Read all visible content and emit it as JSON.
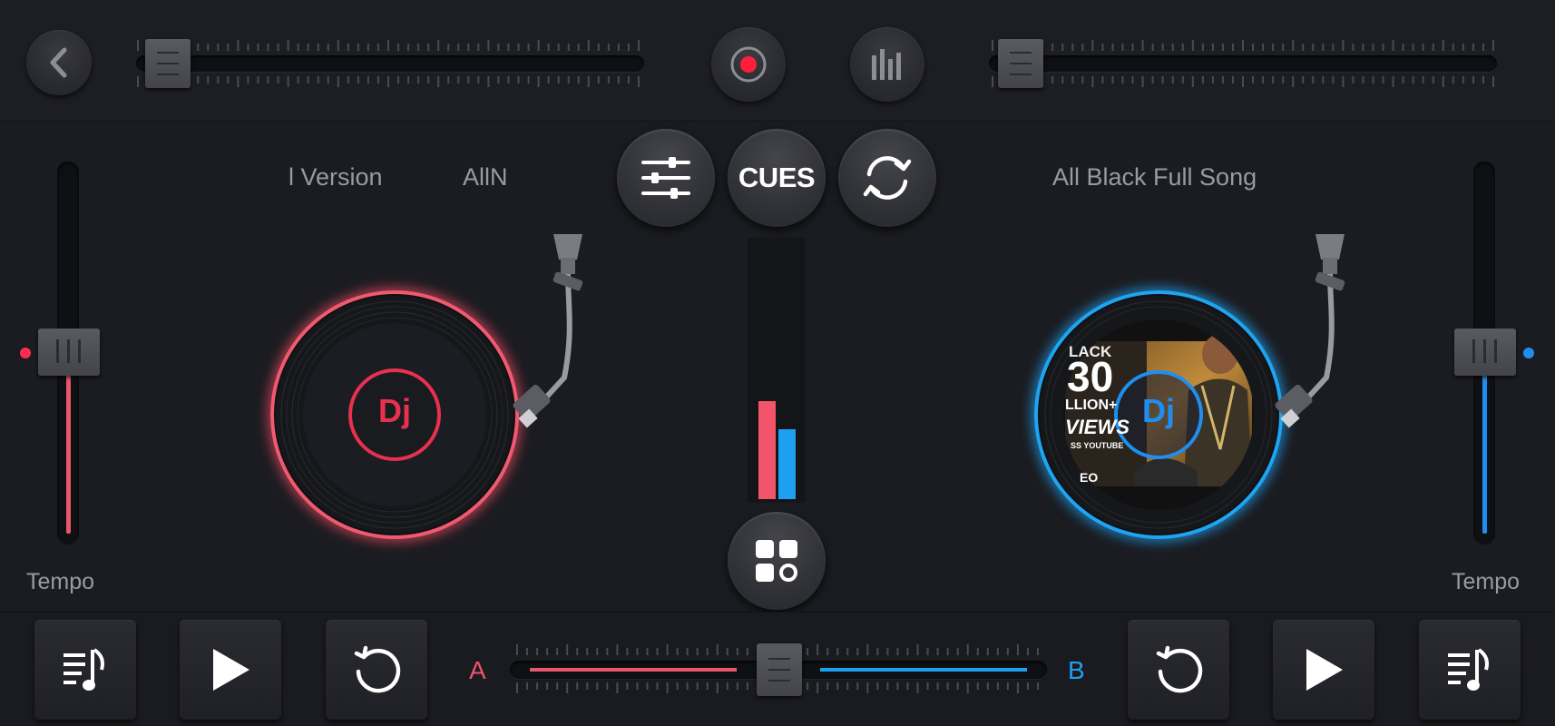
{
  "header": {
    "back_icon": "chevron-left-icon",
    "record_icon": "record-icon",
    "equalizer_icon": "equalizer-bars-icon"
  },
  "center": {
    "mixer_icon": "sliders-icon",
    "cues_label": "CUES",
    "sync_icon": "sync-icon",
    "grid_icon": "pads-grid-icon",
    "level_left": 0.38,
    "level_right": 0.27
  },
  "deck_a": {
    "title_fragment_1": "l Version",
    "title_fragment_2": "AllN",
    "tempo_label": "Tempo",
    "label": "Dj",
    "accent": "#e8304f",
    "tempo_fill": 0.55
  },
  "deck_b": {
    "title": "All Black Full Song",
    "tempo_label": "Tempo",
    "label": "Dj",
    "accent": "#1e8ff0",
    "tempo_fill": 0.55,
    "art_text_1": "LACK",
    "art_text_2": "30",
    "art_text_3": "LLION+",
    "art_text_4": "VIEWS",
    "art_text_5": "SS YOUTUBE",
    "art_text_6": "EO"
  },
  "crossfader": {
    "label_a": "A",
    "label_b": "B",
    "position": 0.5
  },
  "bottom": {
    "playlist_icon": "playlist-icon",
    "play_icon": "play-icon",
    "restart_icon": "restart-icon"
  }
}
